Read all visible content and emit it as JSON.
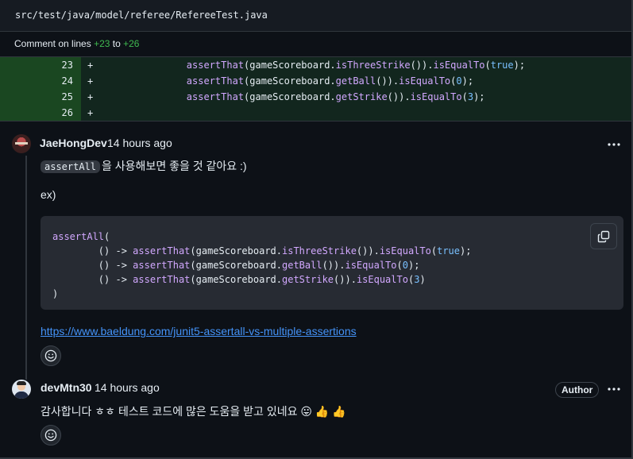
{
  "file_header": {
    "path": "src/test/java/model/referee/RefereeTest.java"
  },
  "comment_range": {
    "prefix": "Comment on lines",
    "start": "+23",
    "to": "to",
    "end": "+26"
  },
  "diff": {
    "lines": [
      {
        "number": "23",
        "sign": "+",
        "pre": "        ",
        "call": "assertThat",
        "a1": "(gameScoreboard.",
        "getter": "isThreeStrike",
        "a2": "()).",
        "matcher": "isEqualTo",
        "a3": "(",
        "value": "true",
        "a4": ");"
      },
      {
        "number": "24",
        "sign": "+",
        "pre": "        ",
        "call": "assertThat",
        "a1": "(gameScoreboard.",
        "getter": "getBall",
        "a2": "()).",
        "matcher": "isEqualTo",
        "a3": "(",
        "value": "0",
        "a4": ");"
      },
      {
        "number": "25",
        "sign": "+",
        "pre": "        ",
        "call": "assertThat",
        "a1": "(gameScoreboard.",
        "getter": "getStrike",
        "a2": "()).",
        "matcher": "isEqualTo",
        "a3": "(",
        "value": "3",
        "a4": ");"
      },
      {
        "number": "26",
        "sign": "+"
      }
    ]
  },
  "comments": [
    {
      "author": "JaeHongDev",
      "time": "14 hours ago",
      "inline_code": "assertAll",
      "text": "을 사용해보면 좋을 것 같아요 :)",
      "ex_label": "ex)",
      "code": {
        "l1_fn": "assertAll",
        "l1_rest": "(",
        "l2_arrow": "        () -> ",
        "l2_fn": "assertThat",
        "l2_a": "(gameScoreboard.",
        "l2_g": "isThreeStrike",
        "l2_b": "()).",
        "l2_m": "isEqualTo",
        "l2_c": "(",
        "l2_v": "true",
        "l2_d": ");",
        "l3_arrow": "        () -> ",
        "l3_fn": "assertThat",
        "l3_a": "(gameScoreboard.",
        "l3_g": "getBall",
        "l3_b": "()).",
        "l3_m": "isEqualTo",
        "l3_c": "(",
        "l3_v": "0",
        "l3_d": ");",
        "l4_arrow": "        () -> ",
        "l4_fn": "assertThat",
        "l4_a": "(gameScoreboard.",
        "l4_g": "getStrike",
        "l4_b": "()).",
        "l4_m": "isEqualTo",
        "l4_c": "(",
        "l4_v": "3",
        "l4_d": ")",
        "l5": ")"
      },
      "link": "https://www.baeldung.com/junit5-assertall-vs-multiple-assertions"
    },
    {
      "author": "devMtn30",
      "time": "14 hours ago",
      "badge": "Author",
      "text": "감사합니다 ㅎㅎ 테스트 코드에 많은 도움을 받고 있네요 😛 👍 👍"
    }
  ],
  "icons": {
    "kebab": "kebab-horizontal-icon",
    "copy": "copy-icon",
    "reaction": "smiley-icon"
  },
  "colors": {
    "added_line_bg": "#12261e",
    "added_num_bg": "#1a4721",
    "link": "#4493f8",
    "code_bg": "#272b33"
  }
}
